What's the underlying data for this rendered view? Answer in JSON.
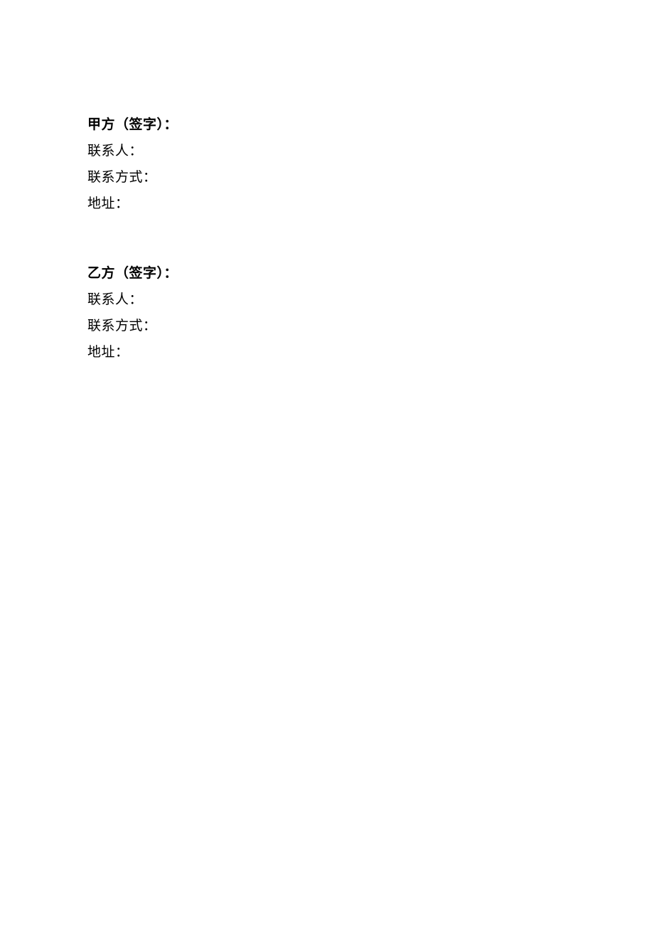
{
  "partyA": {
    "header": "甲方（签字）：",
    "contactLabel": "联系人：",
    "contactMethodLabel": "联系方式：",
    "addressLabel": "地址："
  },
  "partyB": {
    "header": "乙方（签字）：",
    "contactLabel": "联系人：",
    "contactMethodLabel": "联系方式：",
    "addressLabel": "地址："
  }
}
